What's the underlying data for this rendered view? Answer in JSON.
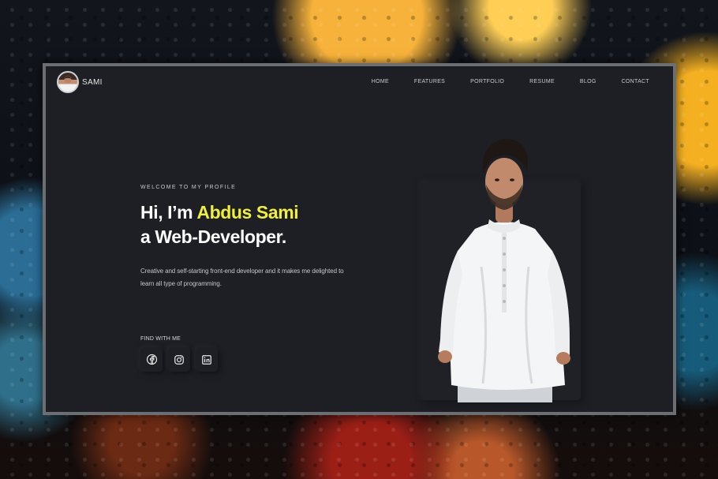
{
  "nav": {
    "brand": "SAMI",
    "items": [
      {
        "label": "HOME"
      },
      {
        "label": "FEATURES"
      },
      {
        "label": "PORTFOLIO"
      },
      {
        "label": "RESUME"
      },
      {
        "label": "BLOG"
      },
      {
        "label": "CONTACT"
      }
    ]
  },
  "hero": {
    "welcome": "WELCOME TO MY PROFILE",
    "greeting": "Hi, I’m ",
    "name": "Abdus Sami",
    "role": "a Web-Developer.",
    "description": "Creative and self-starting front-end developer and it makes me delighted to learn all type of programming."
  },
  "social": {
    "title": "FIND WITH ME",
    "icons": [
      "facebook-icon",
      "instagram-icon",
      "linkedin-icon"
    ]
  },
  "colors": {
    "accent": "#f0f03a",
    "panel": "#1d1f24",
    "text": "#ffffff"
  }
}
